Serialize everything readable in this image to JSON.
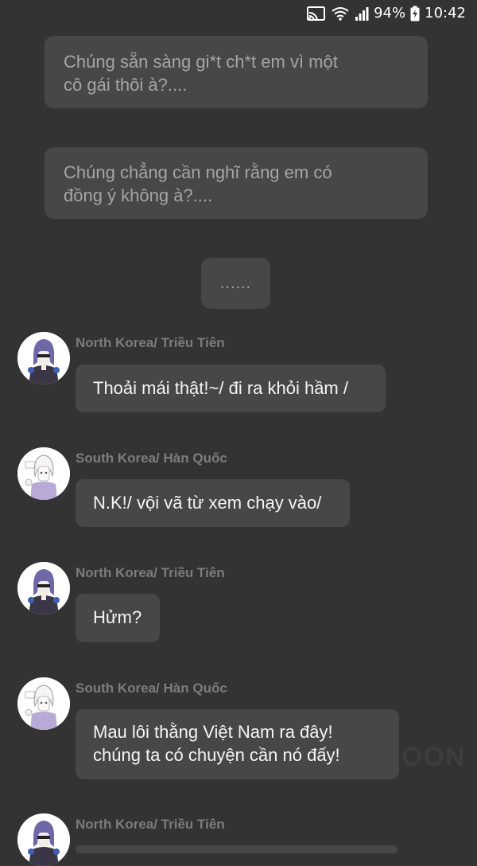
{
  "status_bar": {
    "battery": "94%",
    "time": "10:42",
    "icons": [
      "cast-icon",
      "wifi-icon",
      "signal-icon",
      "battery-charging-icon"
    ]
  },
  "narration": [
    {
      "text_line1": "Chúng sẵn sàng gi*t ch*t em vì một",
      "text_line2": "cô gái thôi à?...."
    },
    {
      "text_line1": "Chúng chẳng cần nghĩ rằng em có",
      "text_line2": "đồng ý không à?...."
    }
  ],
  "ellipsis": "......",
  "messages": [
    {
      "speaker": "North Korea/ Triều Tiên",
      "line1": "Thoải mái thật!~/ đi ra khỏi hầm /",
      "line2": ""
    },
    {
      "speaker": "South Korea/ Hàn Quốc",
      "line1": "N.K!/ vội vã từ xem chạy vào/",
      "line2": ""
    },
    {
      "speaker": "North Korea/ Triều Tiên",
      "line1": "Hửm?",
      "line2": ""
    },
    {
      "speaker": "South Korea/ Hàn Quốc",
      "line1": "Mau lôi thằng Việt Nam ra đây!",
      "line2": "chúng ta có chuyện cần nó đấy!"
    },
    {
      "speaker": "North Korea/ Triều Tiên",
      "line1": "",
      "line2": ""
    }
  ],
  "watermark": "OON",
  "colors": {
    "background": "#333333",
    "bubble": "#474747",
    "narration_text": "#a5a5a5",
    "speaker_text": "#7c7c7c",
    "message_text": "#f5f5f5"
  }
}
